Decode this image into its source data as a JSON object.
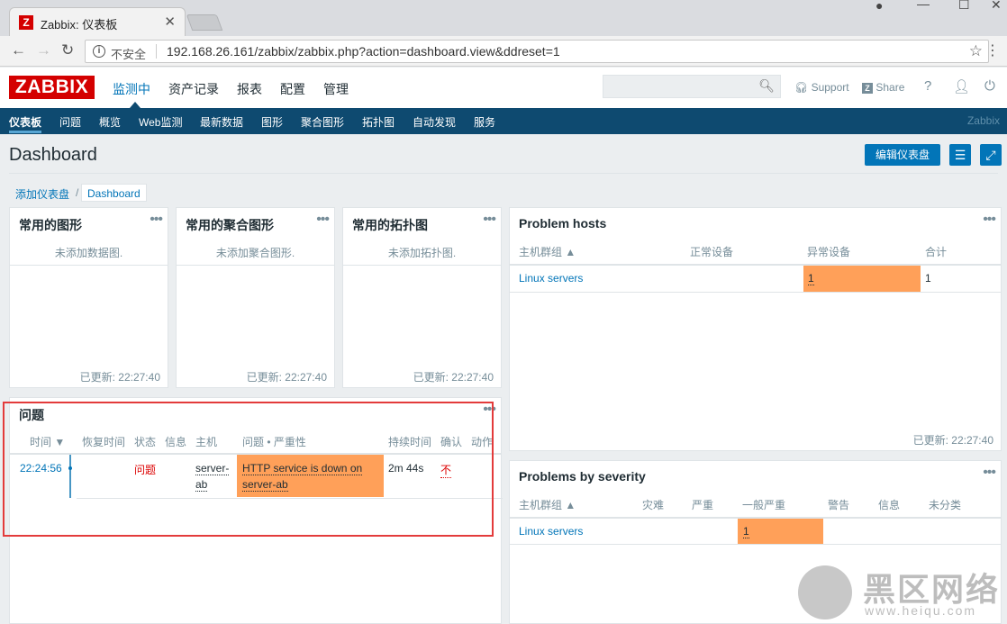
{
  "browser": {
    "tab_title": "Zabbix: 仪表板",
    "favicon_letter": "Z",
    "security_label": "不安全",
    "url": "192.168.26.161/zabbix/zabbix.php?action=dashboard.view&ddreset=1"
  },
  "header": {
    "logo": "ZABBIX",
    "menu": [
      "监测中",
      "资产记录",
      "报表",
      "配置",
      "管理"
    ],
    "support": "Support",
    "share": "Share",
    "help": "?"
  },
  "subnav": {
    "items": [
      "仪表板",
      "问题",
      "概览",
      "Web监测",
      "最新数据",
      "图形",
      "聚合图形",
      "拓扑图",
      "自动发现",
      "服务"
    ],
    "brand": "Zabbix"
  },
  "page": {
    "title": "Dashboard",
    "edit_button": "编辑仪表盘",
    "breadcrumb_root": "添加仪表盘",
    "breadcrumb_current": "Dashboard"
  },
  "widgets": {
    "fav_graphs": {
      "title": "常用的图形",
      "empty": "未添加数据图.",
      "updated": "已更新: 22:27:40"
    },
    "fav_screens": {
      "title": "常用的聚合图形",
      "empty": "未添加聚合图形.",
      "updated": "已更新: 22:27:40"
    },
    "fav_maps": {
      "title": "常用的拓扑图",
      "empty": "未添加拓扑图.",
      "updated": "已更新: 22:27:40"
    },
    "problem_hosts": {
      "title": "Problem hosts",
      "columns": [
        "主机群组 ▲",
        "正常设备",
        "异常设备",
        "合计"
      ],
      "row": {
        "group": "Linux servers",
        "ok": "",
        "problem": "1",
        "total": "1"
      },
      "updated": "已更新: 22:27:40"
    },
    "problems": {
      "title": "问题",
      "columns": [
        "时间 ▼",
        "恢复时间",
        "状态",
        "信息",
        "主机",
        "问题 • 严重性",
        "持续时间",
        "确认",
        "动作"
      ],
      "row": {
        "time": "22:24:56",
        "status": "问题",
        "host_line1": "server-",
        "host_line2": "ab",
        "problem_line1": "HTTP service is down on",
        "problem_line2": "server-ab",
        "duration": "2m 44s",
        "ack": "不"
      }
    },
    "problems_by_severity": {
      "title": "Problems by severity",
      "columns": [
        "主机群组 ▲",
        "灾难",
        "严重",
        "一般严重",
        "警告",
        "信息",
        "未分类"
      ],
      "row": {
        "group": "Linux servers",
        "average": "1"
      }
    }
  },
  "watermark": {
    "text": "黑区网络",
    "url": "www.heiqu.com"
  },
  "colors": {
    "accent": "#0275b8",
    "nav_bg": "#0e4a70",
    "logo_red": "#d40000",
    "average_severity": "#ffa059",
    "highlight_border": "#e33b3b"
  }
}
